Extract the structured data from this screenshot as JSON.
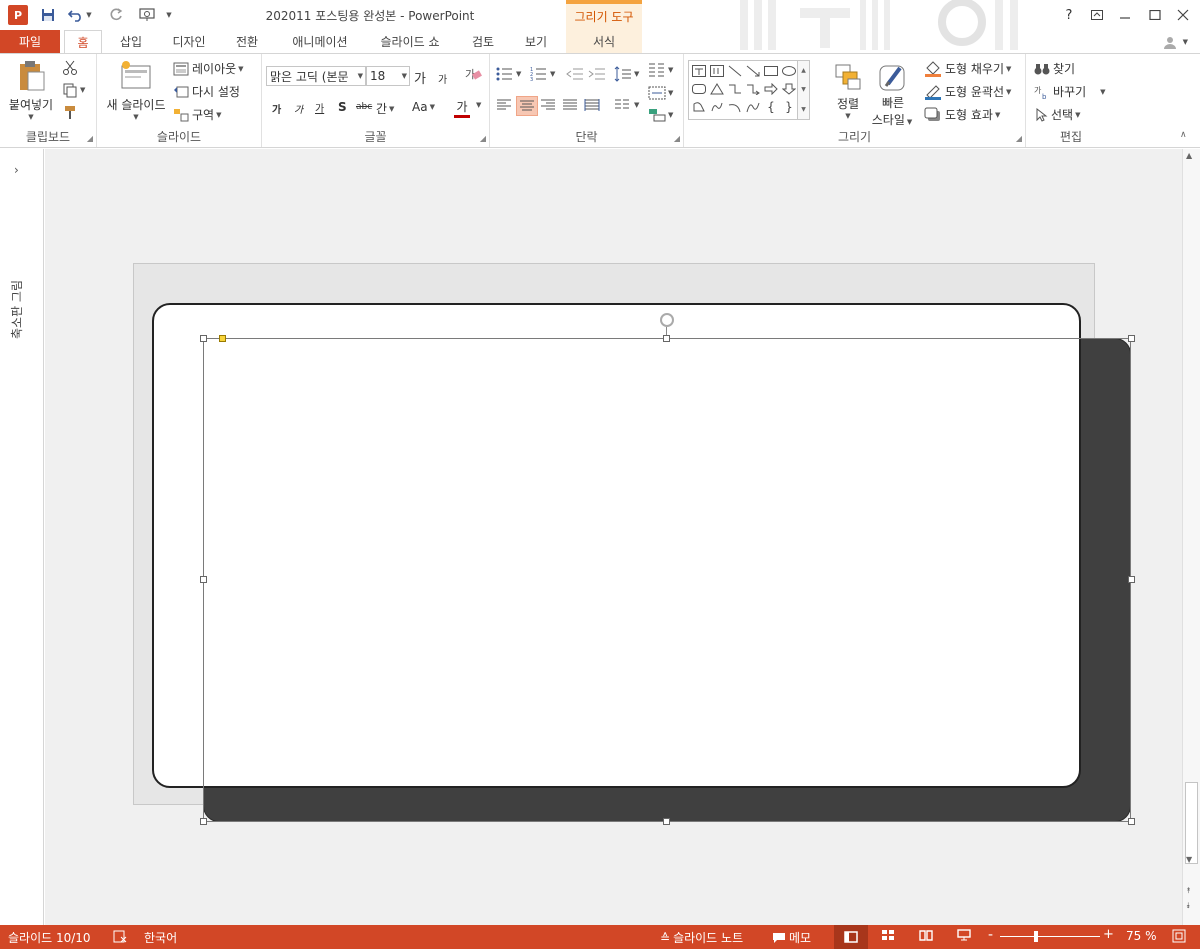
{
  "colors": {
    "accent": "#d24726",
    "context_tab": "#f4a340",
    "dark_shape": "#404040"
  },
  "titlebar": {
    "app_icon_letter": "P",
    "doc_title": "202011 포스팅용 완성본 - PowerPoint",
    "context_group": "그리기 도구",
    "help": "?"
  },
  "tabs": {
    "file": "파일",
    "home": "홈",
    "insert": "삽입",
    "design": "디자인",
    "transitions": "전환",
    "animations": "애니메이션",
    "slideshow": "슬라이드 쇼",
    "review": "검토",
    "view": "보기",
    "format": "서식"
  },
  "ribbon": {
    "clipboard": {
      "label": "클립보드",
      "paste": "붙여넣기"
    },
    "slides": {
      "label": "슬라이드",
      "new_slide": "새 슬라이드",
      "layout": "레이아웃",
      "reset": "다시 설정",
      "section": "구역"
    },
    "font": {
      "label": "글꼴",
      "font_name": "맑은 고딕 (본문",
      "font_size": "18",
      "grow": "가",
      "shrink": "가",
      "bold": "가",
      "italic": "가",
      "underline": "가",
      "shadow": "S",
      "strike": "abc",
      "spacing": "간",
      "case": "Aa",
      "color": "가"
    },
    "paragraph": {
      "label": "단락"
    },
    "drawing": {
      "label": "그리기",
      "arrange": "정렬",
      "quick_styles_line1": "빠른",
      "quick_styles_line2": "스타일",
      "shape_fill": "도형 채우기",
      "shape_outline": "도형 윤곽선",
      "shape_effects": "도형 효과"
    },
    "editing": {
      "label": "편집",
      "find": "찾기",
      "replace": "바꾸기",
      "select": "선택"
    }
  },
  "thumbnail_pane": {
    "label": "축소판 그림"
  },
  "statusbar": {
    "slide_info": "슬라이드 10/10",
    "language": "한국어",
    "notes": "슬라이드 노트",
    "comments": "메모",
    "zoom_minus": "-",
    "zoom_plus": "+",
    "zoom": "75 %"
  }
}
